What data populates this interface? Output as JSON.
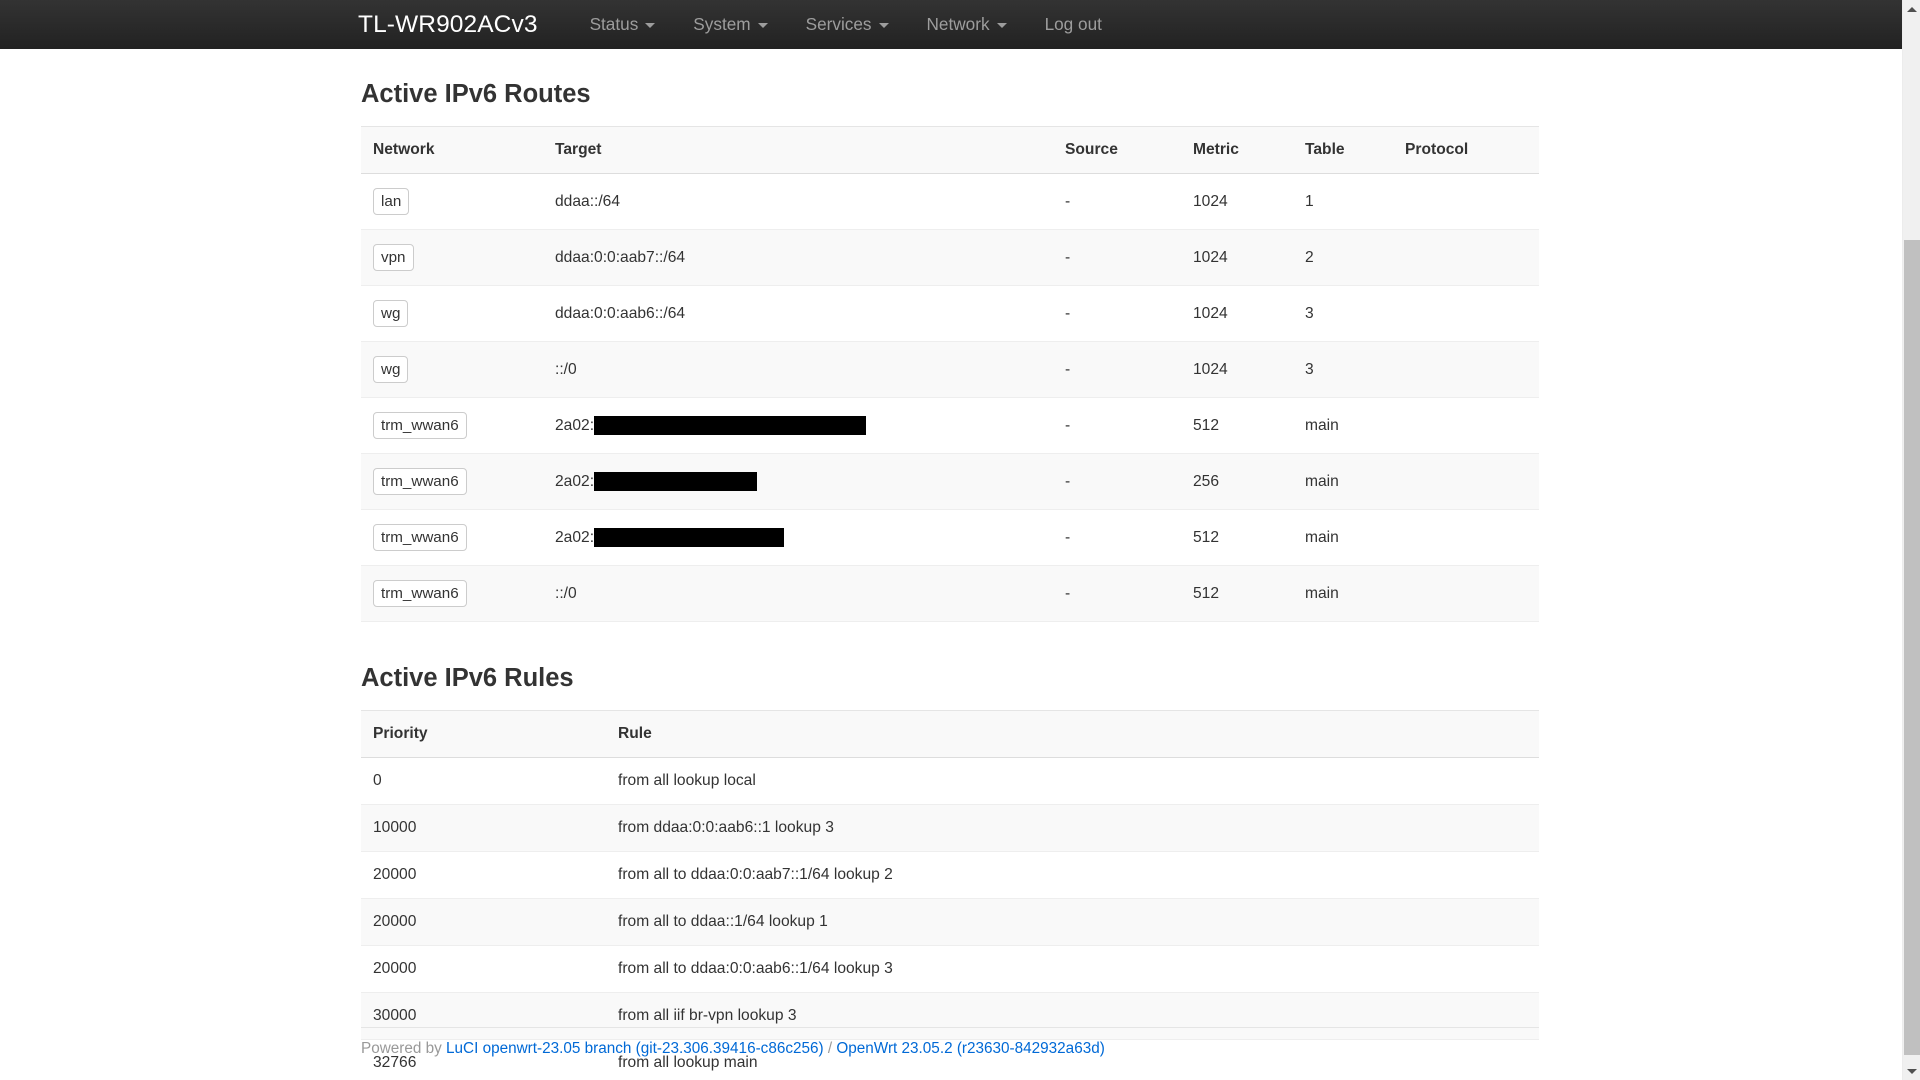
{
  "navbar": {
    "brand": "TL-WR902ACv3",
    "items": [
      {
        "label": "Status",
        "has_caret": true,
        "name": "nav-item-status"
      },
      {
        "label": "System",
        "has_caret": true,
        "name": "nav-item-system"
      },
      {
        "label": "Services",
        "has_caret": true,
        "name": "nav-item-services"
      },
      {
        "label": "Network",
        "has_caret": true,
        "name": "nav-item-network"
      },
      {
        "label": "Log out",
        "has_caret": false,
        "name": "nav-item-logout"
      }
    ]
  },
  "routes_section": {
    "title": "Active IPv6 Routes",
    "columns": [
      "Network",
      "Target",
      "Source",
      "Metric",
      "Table",
      "Protocol"
    ],
    "rows": [
      {
        "network": "lan",
        "target": "ddaa::/64",
        "target_prefix": "",
        "redact_width": 0,
        "source": "-",
        "metric": "1024",
        "table": "1",
        "protocol": ""
      },
      {
        "network": "vpn",
        "target": "ddaa:0:0:aab7::/64",
        "target_prefix": "",
        "redact_width": 0,
        "source": "-",
        "metric": "1024",
        "table": "2",
        "protocol": ""
      },
      {
        "network": "wg",
        "target": "ddaa:0:0:aab6::/64",
        "target_prefix": "",
        "redact_width": 0,
        "source": "-",
        "metric": "1024",
        "table": "3",
        "protocol": ""
      },
      {
        "network": "wg",
        "target": "::/0",
        "target_prefix": "",
        "redact_width": 0,
        "source": "-",
        "metric": "1024",
        "table": "3",
        "protocol": ""
      },
      {
        "network": "trm_wwan6",
        "target": "",
        "target_prefix": "2a02:",
        "redact_width": 272,
        "source": "-",
        "metric": "512",
        "table": "main",
        "protocol": ""
      },
      {
        "network": "trm_wwan6",
        "target": "",
        "target_prefix": "2a02:",
        "redact_width": 163,
        "source": "-",
        "metric": "256",
        "table": "main",
        "protocol": ""
      },
      {
        "network": "trm_wwan6",
        "target": "",
        "target_prefix": "2a02:",
        "redact_width": 190,
        "source": "-",
        "metric": "512",
        "table": "main",
        "protocol": ""
      },
      {
        "network": "trm_wwan6",
        "target": "::/0",
        "target_prefix": "",
        "redact_width": 0,
        "source": "-",
        "metric": "512",
        "table": "main",
        "protocol": ""
      }
    ]
  },
  "rules_section": {
    "title": "Active IPv6 Rules",
    "columns": [
      "Priority",
      "Rule"
    ],
    "rows": [
      {
        "priority": "0",
        "rule": "from all lookup local"
      },
      {
        "priority": "10000",
        "rule": "from ddaa:0:0:aab6::1 lookup 3"
      },
      {
        "priority": "20000",
        "rule": "from all to ddaa:0:0:aab7::1/64 lookup 2"
      },
      {
        "priority": "20000",
        "rule": "from all to ddaa::1/64 lookup 1"
      },
      {
        "priority": "20000",
        "rule": "from all to ddaa:0:0:aab6::1/64 lookup 3"
      },
      {
        "priority": "30000",
        "rule": "from all iif br-vpn lookup 3"
      },
      {
        "priority": "32766",
        "rule": "from all lookup main"
      }
    ]
  },
  "footer": {
    "powered_by": "Powered by ",
    "luci_link": "LuCI openwrt-23.05 branch (git-23.306.39416-c86c256)",
    "separator": " / ",
    "openwrt_link": "OpenWrt 23.05.2 (r23630-842932a63d)"
  },
  "scrollbar": {
    "up_arrow": "scroll-up-arrow",
    "down_arrow": "scroll-down-arrow"
  },
  "colors": {
    "navbar_bg": "#222222",
    "brand_text": "#ffffff",
    "nav_text": "#9d9d9d",
    "link": "#0069d6",
    "body_text": "#333333",
    "row_alt": "#f9f9f9",
    "redaction": "#000000"
  }
}
